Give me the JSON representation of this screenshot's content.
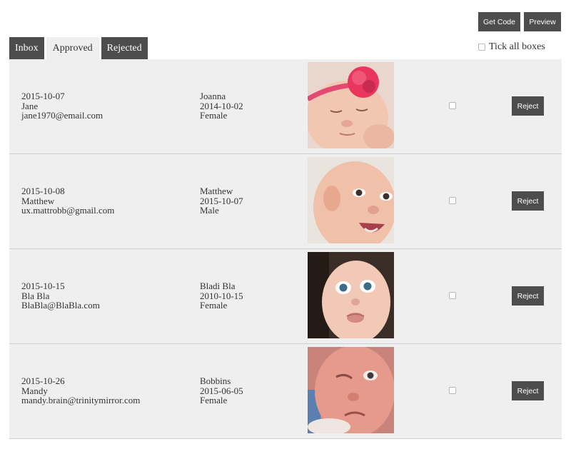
{
  "toolbar": {
    "get_code_label": "Get Code",
    "preview_label": "Preview"
  },
  "tabs": [
    {
      "label": "Inbox",
      "active": false
    },
    {
      "label": "Approved",
      "active": true
    },
    {
      "label": "Rejected",
      "active": false
    }
  ],
  "tick_all_label": "Tick all boxes",
  "entries": [
    {
      "date": "2015-10-07",
      "parent_name": "Jane",
      "email": "jane1970@email.com",
      "baby_name": "Joanna",
      "birth_date": "2014-10-02",
      "gender": "Female",
      "photo_subject": "sleeping baby with pink flower headband",
      "checked": false,
      "reject_label": "Reject"
    },
    {
      "date": "2015-10-08",
      "parent_name": "Matthew",
      "email": "ux.mattrobb@gmail.com",
      "baby_name": "Matthew",
      "birth_date": "2015-10-07",
      "gender": "Male",
      "photo_subject": "smiling baby",
      "checked": false,
      "reject_label": "Reject"
    },
    {
      "date": "2015-10-15",
      "parent_name": "Bla Bla",
      "email": "BlaBla@BlaBla.com",
      "baby_name": "Bladi Bla",
      "birth_date": "2010-10-15",
      "gender": "Female",
      "photo_subject": "wide-eyed baby",
      "checked": false,
      "reject_label": "Reject"
    },
    {
      "date": "2015-10-26",
      "parent_name": "Mandy",
      "email": "mandy.brain@trinitymirror.com",
      "baby_name": "Bobbins",
      "birth_date": "2015-06-05",
      "gender": "Female",
      "photo_subject": "frowning newborn",
      "checked": false,
      "reject_label": "Reject"
    }
  ],
  "colors": {
    "button_bg": "#4d4d4d",
    "row_bg": "#efefef",
    "divider": "#cfcfcf",
    "text": "#333333"
  }
}
